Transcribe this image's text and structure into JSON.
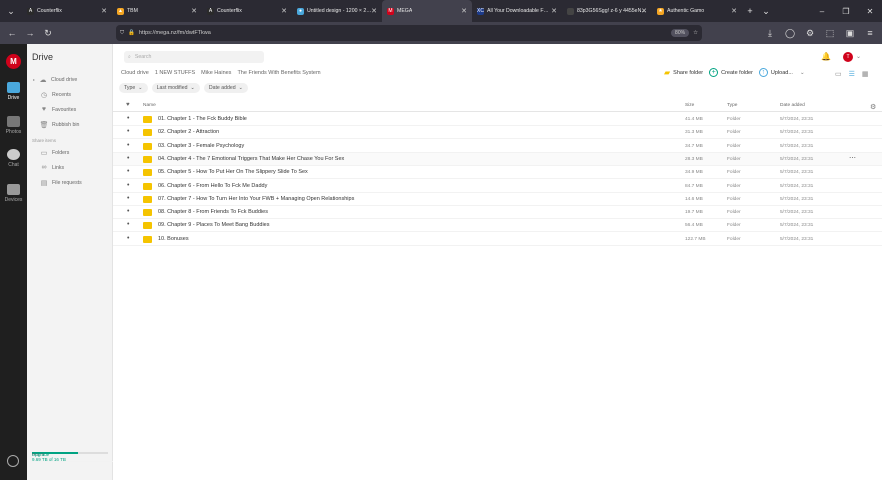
{
  "browser": {
    "tabs": [
      {
        "label": "Counterflix",
        "fav": "A",
        "color": "#2a2a2a"
      },
      {
        "label": "TBM",
        "fav": "▲",
        "color": "#f5a623"
      },
      {
        "label": "Counterflix",
        "fav": "A",
        "color": "#2a2a2a"
      },
      {
        "label": "Untitled design - 1200 × 2…",
        "fav": "●",
        "color": "#4aa8dc"
      },
      {
        "label": "MEGA",
        "fav": "M",
        "color": "#d0021b",
        "active": true
      },
      {
        "label": "All Your Downloadable F…",
        "fav": "XC",
        "color": "#1d3b8a"
      },
      {
        "label": "83p3G56Sgg! z-6 y 4455eN…",
        "fav": "",
        "color": "#444"
      },
      {
        "label": "Authentic Gamo",
        "fav": "★",
        "color": "#f5a623"
      }
    ],
    "url": "https://mega.nz/fm/dwtFTkwa",
    "zoom": "80%"
  },
  "rail": {
    "items": [
      {
        "label": "Drive"
      },
      {
        "label": "Photos"
      },
      {
        "label": "Chat"
      },
      {
        "label": "Devices"
      }
    ]
  },
  "sidebar": {
    "title": "Drive",
    "items": [
      {
        "label": "Cloud drive",
        "icon": "☁"
      },
      {
        "label": "Recents",
        "icon": "◷"
      },
      {
        "label": "Favourites",
        "icon": "♥"
      },
      {
        "label": "Rubbish bin",
        "icon": "🗑"
      }
    ],
    "shared_title": "Share items",
    "shared_items": [
      {
        "label": "Folders",
        "icon": "▭"
      },
      {
        "label": "Links",
        "icon": "∞"
      },
      {
        "label": "File requests",
        "icon": "▤"
      }
    ],
    "storage": {
      "plan": "Pro III",
      "upgrade": "Upgrade",
      "used": "9.69 TB of 16 TB",
      "fraction": 0.6
    }
  },
  "main": {
    "search_placeholder": "Search",
    "avatar": "T",
    "breadcrumbs": [
      "Cloud drive",
      "1 NEW STUFFS",
      "Mike Haines",
      "The Friends With Benefits System"
    ],
    "actions": {
      "share": "Share folder",
      "create": "Create folder",
      "upload": "Upload..."
    },
    "filters": [
      "Type",
      "Last modified",
      "Date added"
    ],
    "columns": {
      "name": "Name",
      "size": "Size",
      "type": "Type",
      "date": "Date added"
    },
    "rows": [
      {
        "name": "01. Chapter 1 - The Fck Buddy Bible",
        "size": "41.4 MB",
        "type": "Folder",
        "date": "5/7/2024, 23:31"
      },
      {
        "name": "02. Chapter 2 - Attraction",
        "size": "31.3 MB",
        "type": "Folder",
        "date": "5/7/2024, 23:31"
      },
      {
        "name": "03. Chapter 3 - Female Psychology",
        "size": "34.7 MB",
        "type": "Folder",
        "date": "5/7/2024, 23:31"
      },
      {
        "name": "04. Chapter 4 - The 7 Emotional Triggers That Make Her Chase You For Sex",
        "size": "28.3 MB",
        "type": "Folder",
        "date": "5/7/2024, 23:31"
      },
      {
        "name": "05. Chapter 5 - How To Put Her On The Slippery Slide To Sex",
        "size": "34.9 MB",
        "type": "Folder",
        "date": "5/7/2024, 23:31"
      },
      {
        "name": "06. Chapter 6 - From Hello To Fck Me Daddy",
        "size": "84.7 MB",
        "type": "Folder",
        "date": "5/7/2024, 23:31"
      },
      {
        "name": "07. Chapter 7 - How To Turn Her Into Your FWB + Managing Open Relationships",
        "size": "14.6 MB",
        "type": "Folder",
        "date": "5/7/2024, 23:31"
      },
      {
        "name": "08. Chapter 8 - From Friends To Fck Buddies",
        "size": "19.7 MB",
        "type": "Folder",
        "date": "5/7/2024, 23:31"
      },
      {
        "name": "09. Chapter 9 - Places To Meet Bang Buddies",
        "size": "56.4 MB",
        "type": "Folder",
        "date": "5/7/2024, 23:31"
      },
      {
        "name": "10. Bonuses",
        "size": "122.7 MB",
        "type": "Folder",
        "date": "5/7/2024, 23:31"
      }
    ]
  }
}
